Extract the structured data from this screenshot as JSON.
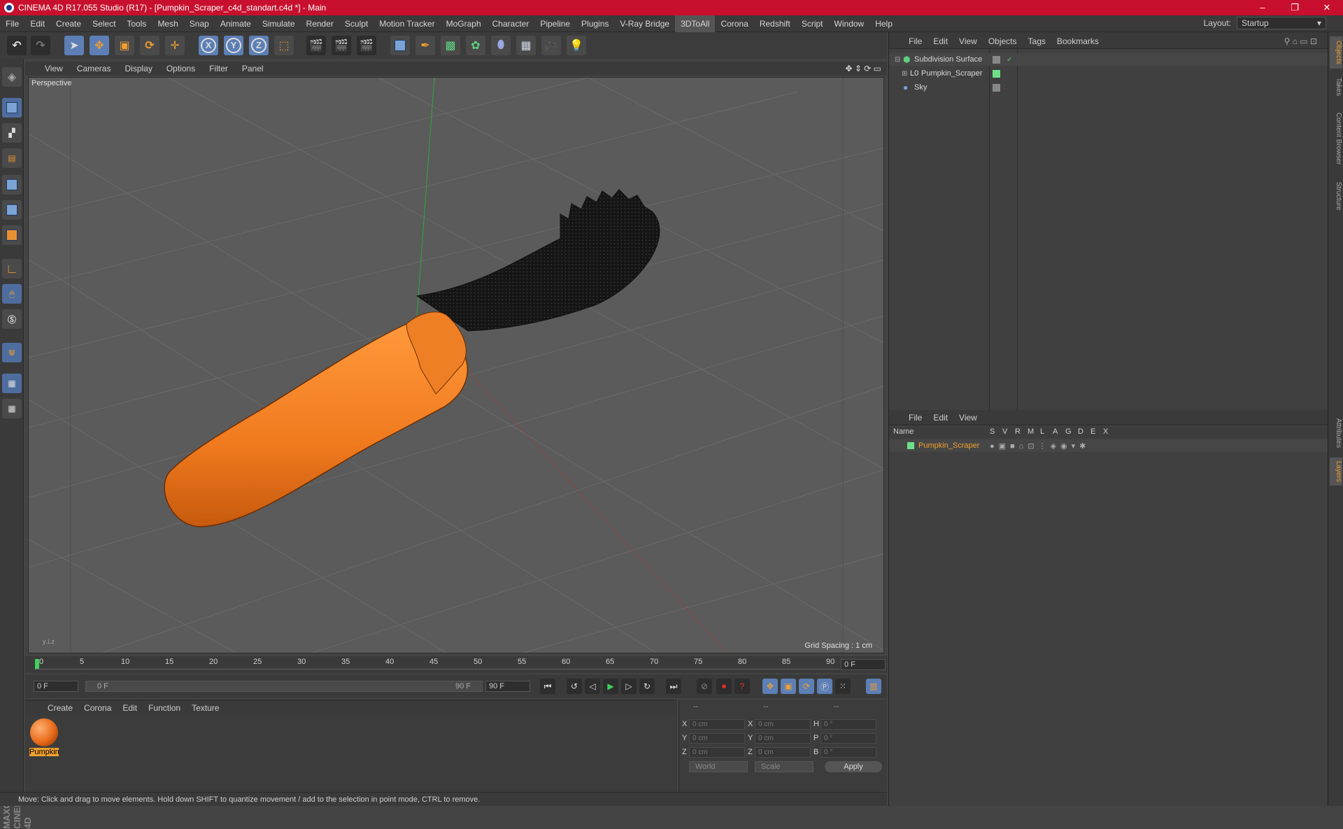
{
  "window": {
    "title": "CINEMA 4D R17.055 Studio (R17) - [Pumpkin_Scraper_c4d_standart.c4d *] - Main",
    "controls": [
      "–",
      "❐",
      "✕"
    ]
  },
  "menu": {
    "items": [
      "File",
      "Edit",
      "Create",
      "Select",
      "Tools",
      "Mesh",
      "Snap",
      "Animate",
      "Simulate",
      "Render",
      "Sculpt",
      "Motion Tracker",
      "MoGraph",
      "Character",
      "Pipeline",
      "Plugins",
      "V-Ray Bridge",
      "3DToAll",
      "Corona",
      "Redshift",
      "Script",
      "Window",
      "Help"
    ],
    "layout_label": "Layout:",
    "layout_value": "Startup"
  },
  "toolbar": {
    "axis_x": "X",
    "axis_y": "Y",
    "axis_z": "Z"
  },
  "viewport": {
    "menu": [
      "View",
      "Cameras",
      "Display",
      "Options",
      "Filter",
      "Panel"
    ],
    "label": "Perspective",
    "grid_spacing": "Grid Spacing : 1 cm"
  },
  "timeline": {
    "ticks": [
      "0",
      "5",
      "10",
      "15",
      "20",
      "25",
      "30",
      "35",
      "40",
      "45",
      "50",
      "55",
      "60",
      "65",
      "70",
      "75",
      "80",
      "85",
      "90"
    ],
    "current_frame": "0 F",
    "start_field": "0 F",
    "range_start": "0 F",
    "range_end": "90 F",
    "end_field": "90 F"
  },
  "materials": {
    "menu": [
      "Create",
      "Corona",
      "Edit",
      "Function",
      "Texture"
    ],
    "items": [
      {
        "name": "Pumpkin"
      }
    ]
  },
  "coordinates": {
    "header": [
      "--",
      "--",
      "--"
    ],
    "rows": [
      {
        "a": "X",
        "v1": "0 cm",
        "b": "X",
        "v2": "0 cm",
        "c": "H",
        "v3": "0 °"
      },
      {
        "a": "Y",
        "v1": "0 cm",
        "b": "Y",
        "v2": "0 cm",
        "c": "P",
        "v3": "0 °"
      },
      {
        "a": "Z",
        "v1": "0 cm",
        "b": "Z",
        "v2": "0 cm",
        "c": "B",
        "v3": "0 °"
      }
    ],
    "space": "World",
    "mode": "Scale",
    "apply": "Apply"
  },
  "status": "Move: Click and drag to move elements. Hold down SHIFT to quantize movement / add to the selection in point mode, CTRL to remove.",
  "objects": {
    "menu": [
      "File",
      "Edit",
      "View",
      "Objects",
      "Tags",
      "Bookmarks"
    ],
    "items": [
      {
        "name": "Subdivision Surface"
      },
      {
        "name": "Pumpkin_Scraper"
      },
      {
        "name": "Sky"
      }
    ]
  },
  "layers": {
    "menu": [
      "File",
      "Edit",
      "View"
    ],
    "columns": [
      "Name",
      "S",
      "V",
      "R",
      "M",
      "L",
      "A",
      "G",
      "D",
      "E",
      "X"
    ],
    "items": [
      {
        "name": "Pumpkin_Scraper"
      }
    ]
  },
  "side_tabs": [
    "Objects",
    "Takes",
    "Content Browser",
    "Structure",
    "Attributes",
    "Layers"
  ],
  "brand": "MAXON CINEMA 4D",
  "colors": {
    "title_bar": "#c8102e",
    "accent": "#f0a030",
    "handle": "#f07a1e",
    "head": "#1a1a1a",
    "selection_blue": "#5d7fb5"
  }
}
